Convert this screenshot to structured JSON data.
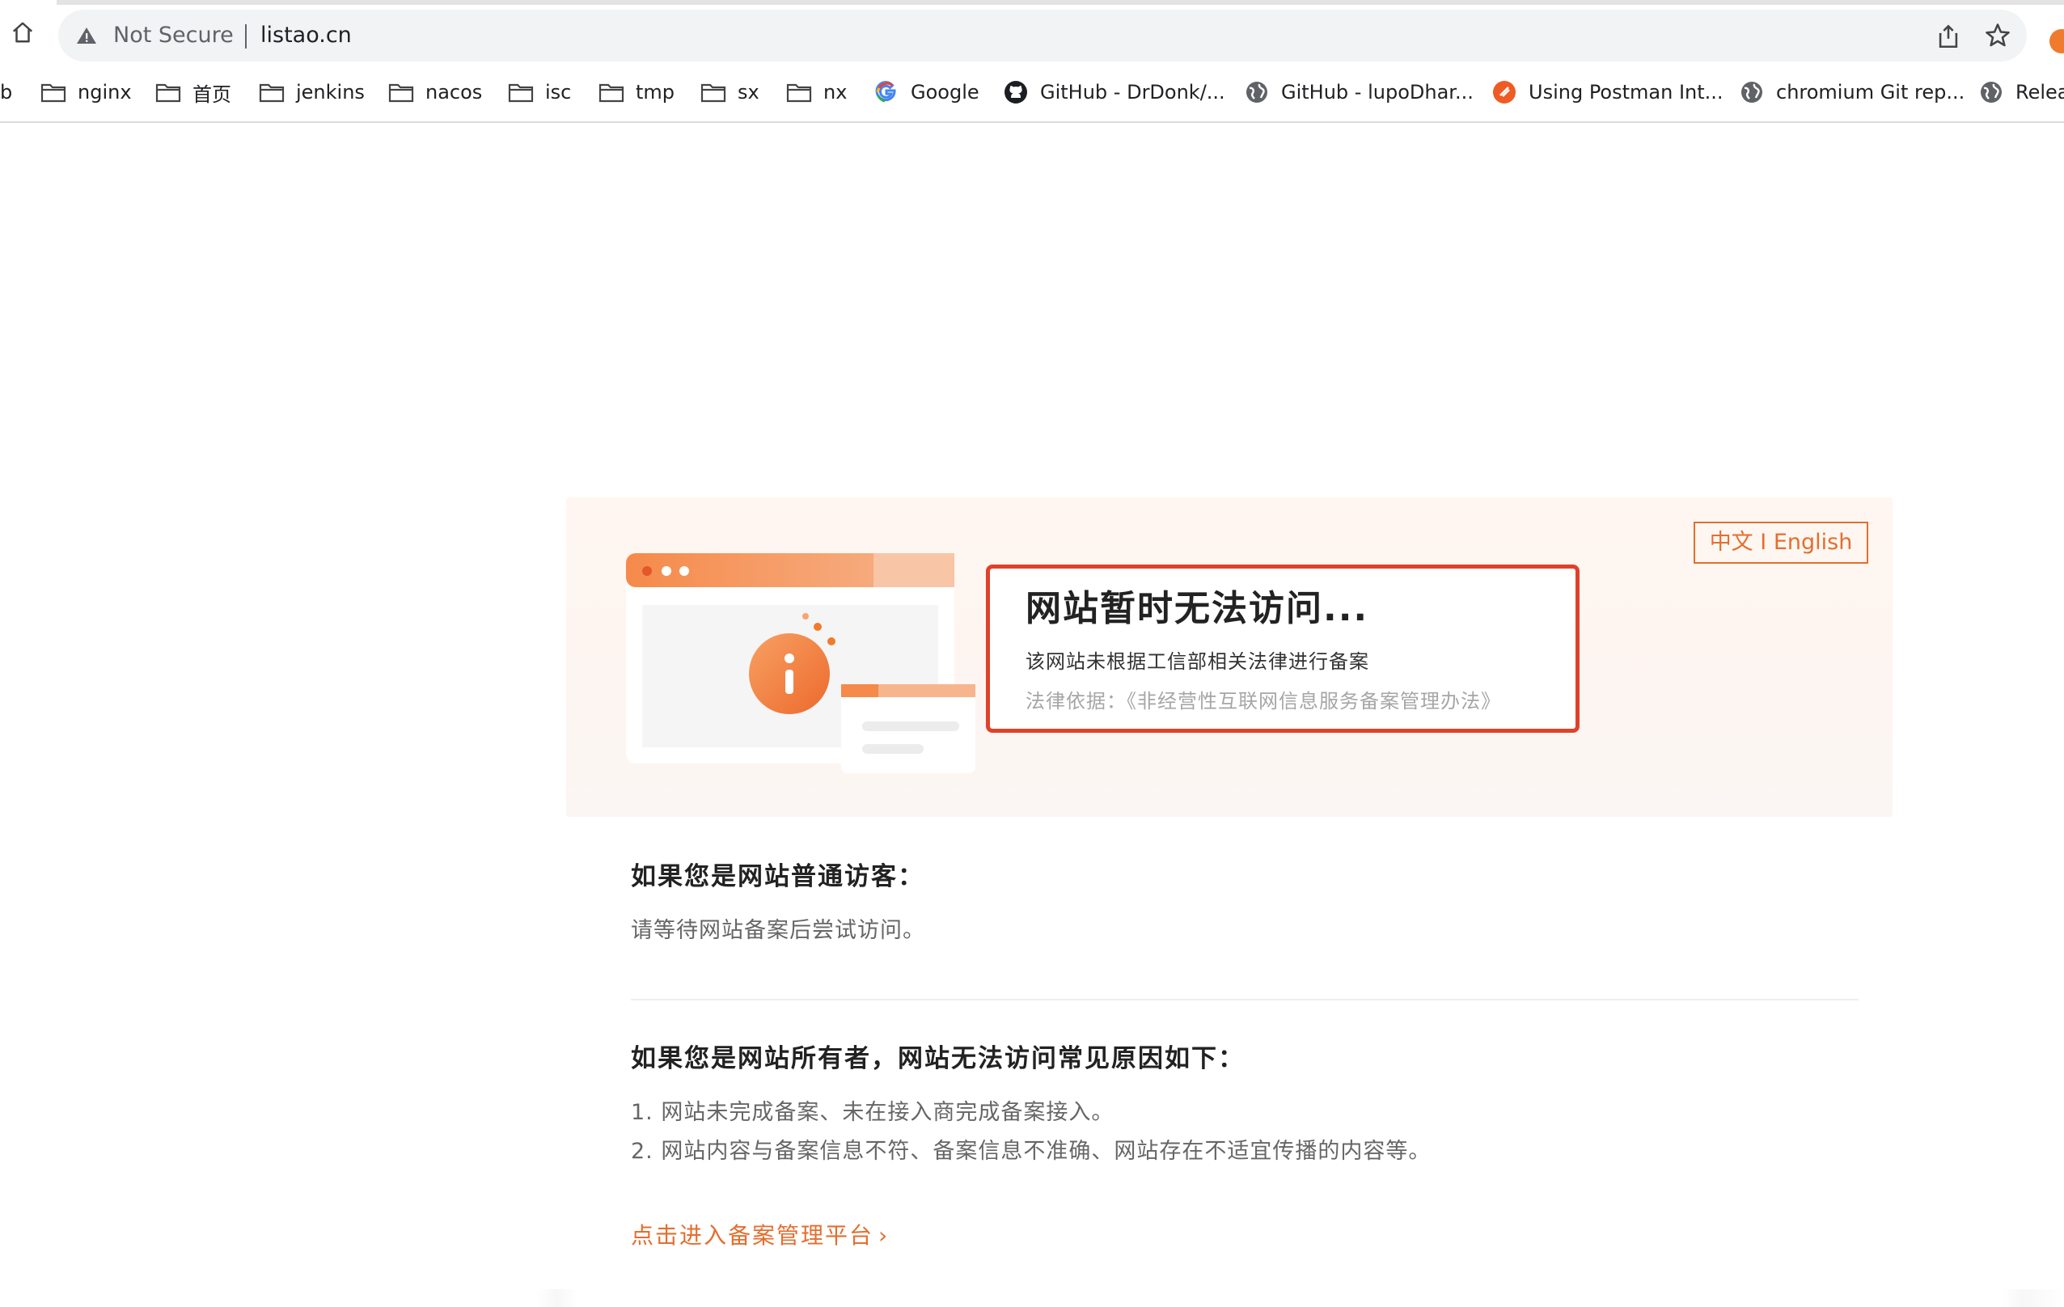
{
  "browser": {
    "security_label": "Not Secure",
    "url": "listao.cn",
    "bookmarks": [
      {
        "label": "b",
        "icon": "none"
      },
      {
        "label": "nginx",
        "icon": "folder-icon"
      },
      {
        "label": "首页",
        "icon": "folder-icon"
      },
      {
        "label": "jenkins",
        "icon": "folder-icon"
      },
      {
        "label": "nacos",
        "icon": "folder-icon"
      },
      {
        "label": "isc",
        "icon": "folder-icon"
      },
      {
        "label": "tmp",
        "icon": "folder-icon"
      },
      {
        "label": "sx",
        "icon": "folder-icon"
      },
      {
        "label": "nx",
        "icon": "folder-icon"
      },
      {
        "label": "Google",
        "icon": "google-icon"
      },
      {
        "label": "GitHub - DrDonk/...",
        "icon": "github-icon"
      },
      {
        "label": "GitHub - lupoDhar...",
        "icon": "globe-icon"
      },
      {
        "label": "Using Postman Int...",
        "icon": "postman-icon"
      },
      {
        "label": "chromium Git rep...",
        "icon": "globe-icon"
      },
      {
        "label": "Relea",
        "icon": "globe-icon"
      }
    ]
  },
  "page": {
    "lang_switch": "中文 I English",
    "notice": {
      "title": "网站暂时无法访问...",
      "subtitle": "该网站未根据工信部相关法律进行备案",
      "law": "法律依据：《非经营性互联网信息服务备案管理办法》"
    },
    "visitor_title": "如果您是网站普通访客：",
    "visitor_text": "请等待网站备案后尝试访问。",
    "owner_title": "如果您是网站所有者，网站无法访问常见原因如下：",
    "owner_items": [
      "1. 网站未完成备案、未在接入商完成备案接入。",
      "2. 网站内容与备案信息不符、备案信息不准确、网站存在不适宜传播的内容等。"
    ],
    "link_text": "点击进入备案管理平台",
    "link_chevron": "›"
  },
  "colors": {
    "accent": "#e46e2e",
    "notice_border": "#e0412a"
  }
}
